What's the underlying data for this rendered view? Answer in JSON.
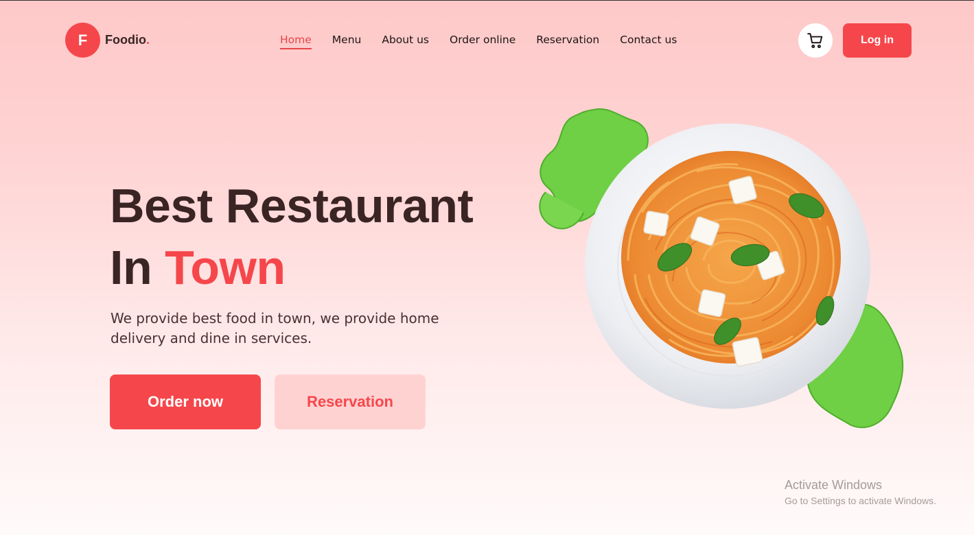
{
  "brand": {
    "badge": "F",
    "name": "Foodio",
    "dot": "."
  },
  "nav": {
    "items": [
      {
        "label": "Home",
        "active": true
      },
      {
        "label": "Menu",
        "active": false
      },
      {
        "label": "About us",
        "active": false
      },
      {
        "label": "Order online",
        "active": false
      },
      {
        "label": "Reservation",
        "active": false
      },
      {
        "label": "Contact us",
        "active": false
      }
    ]
  },
  "header": {
    "cart_icon": "cart-icon",
    "login_label": "Log in"
  },
  "hero": {
    "title_line1": "Best Restaurant",
    "title_line2_prefix": "In ",
    "title_line2_accent": "Town",
    "description": "We provide best food in town, we provide home delivery and dine in services.",
    "order_button": "Order now",
    "reservation_button": "Reservation"
  },
  "watermark": {
    "title": "Activate Windows",
    "subtitle": "Go to Settings to activate Windows."
  },
  "colors": {
    "accent": "#f5474b",
    "accent_light": "#ffd2d2",
    "text_dark": "#3a2424",
    "background_top": "#fec8c8",
    "background_bottom": "#fffafa"
  }
}
